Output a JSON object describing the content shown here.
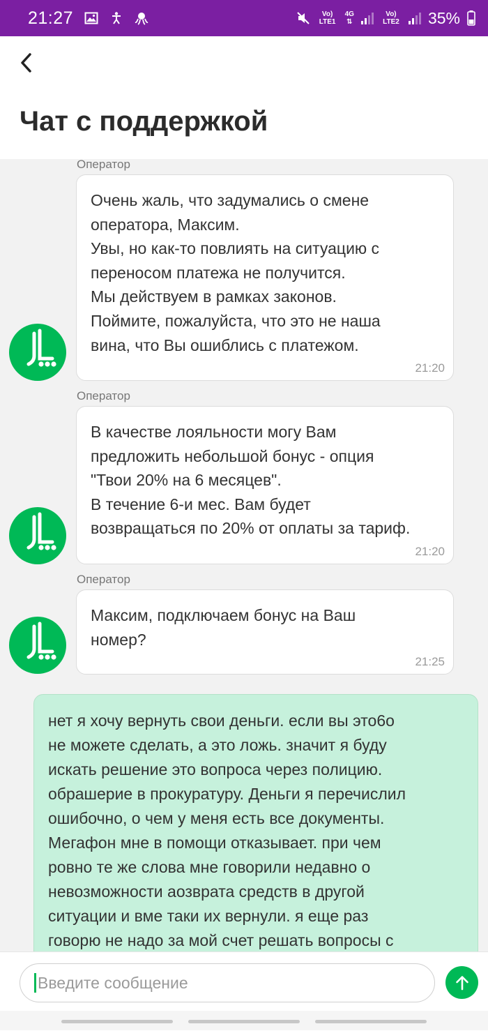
{
  "status_bar": {
    "time": "21:27",
    "battery_percent": "35%",
    "sim1_label": "Vo) LTE1",
    "sim1_tech": "4G",
    "sim2_label": "Vo) LTE2",
    "left_icons": [
      "image-icon",
      "accessibility-icon",
      "octopus-icon"
    ],
    "right_icons": [
      "mute-icon",
      "signal-icon",
      "battery-icon"
    ],
    "background": "#7b1fa2"
  },
  "header": {
    "back_icon": "chevron-left-icon",
    "title": "Чат с поддержкой"
  },
  "brand": {
    "accent": "#00b956",
    "user_bubble": "#c6f1dc"
  },
  "messages": [
    {
      "sender": "Оператор",
      "avatar": "megafon-logo",
      "lines": [
        "Очень жаль, что задумались о смене",
        "оператора, Максим.",
        "Увы, но как-то повлиять на ситуацию с",
        "переносом платежа не получится.",
        "Мы действуем в рамках законов.",
        "Поймите, пожалуйста, что это не наша",
        "вина, что Вы ошиблись с платежом."
      ],
      "time": "21:20"
    },
    {
      "sender": "Оператор",
      "avatar": "megafon-logo",
      "lines": [
        "В качестве лояльности могу Вам",
        "предложить небольшой бонус - опция",
        "\"Твои 20% на 6 месяцев\".",
        "В течение 6-и мес. Вам будет",
        "возвращаться по 20% от оплаты за тариф."
      ],
      "time": "21:20"
    },
    {
      "sender": "Оператор",
      "avatar": "megafon-logo",
      "lines": [
        "Максим, подключаем бонус на Ваш",
        "номер?"
      ],
      "time": "21:25"
    },
    {
      "sender": "user",
      "lines": [
        "нет я хочу вернуть свои деньги. если вы это6о",
        "не можете сделать, а это ложь. значит я буду",
        "искать решение это вопроса через полицию.",
        "обрашерие в прокуратуру. Деньги я перечислил",
        "ошибочно, о чем у меня есть все документы.",
        "Мегафон мне в помощи отказывает. при чем",
        "ровно те же слова мне говорили недавно о",
        "невозможности аозврата средств в другой",
        "ситуации и вме таки их вернули. я еще раз",
        "говорю не надо за мой счет решать вопросы с"
      ]
    }
  ],
  "composer": {
    "placeholder": "Введите сообщение",
    "value": "",
    "send_icon": "arrow-up-icon"
  }
}
